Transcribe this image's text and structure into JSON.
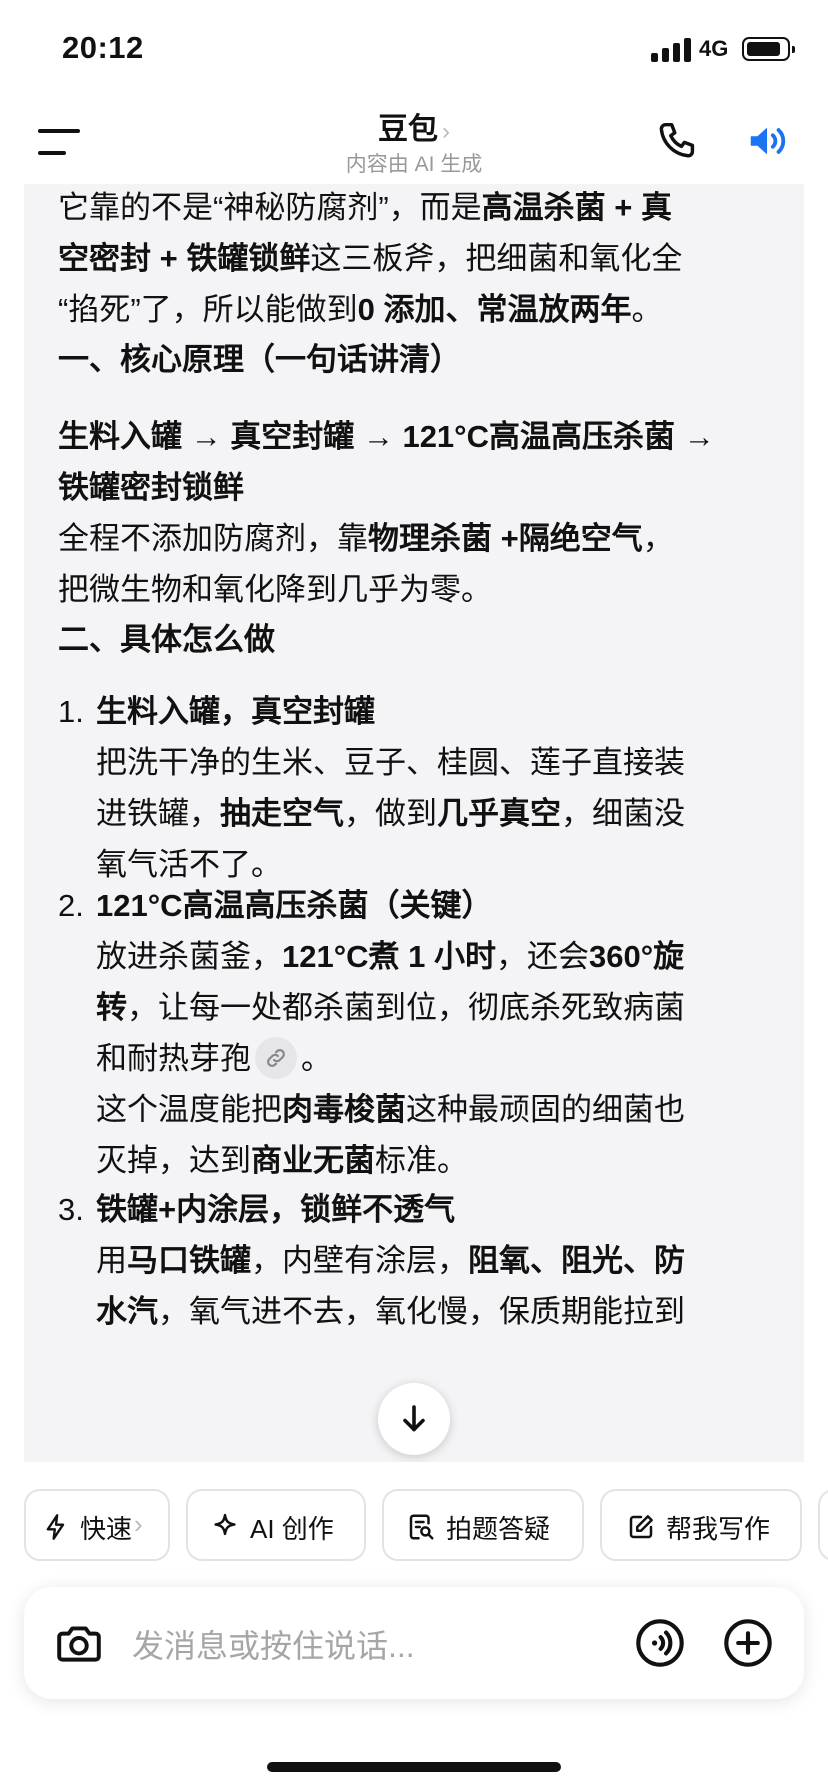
{
  "status": {
    "time": "20:12",
    "network": "4G"
  },
  "nav": {
    "title": "豆包",
    "chevron": "›",
    "subtitle": "内容由 AI 生成"
  },
  "message": {
    "intro_1a": "它靠的不是“神秘防腐剂”，而是",
    "intro_1b": "高温杀菌 + 真",
    "intro_2a": "空密封 + 铁罐锁鲜",
    "intro_2b": "这三板斧，把细菌和氧化全",
    "intro_3a": "“掐死”了，所以能做到",
    "intro_3b": "0 添加、常温放两年",
    "intro_3c": "。",
    "h1": "一、核心原理（一句话讲清）",
    "flow_1": "生料入罐 → 真空封罐 → 121°C高温高压杀菌 →",
    "flow_2": "铁罐密封锁鲜",
    "p1_1a": "全程不添加防腐剂，靠",
    "p1_1b": "物理杀菌 +隔绝空气",
    "p1_1c": "，",
    "p1_2": "把微生物和氧化降到几乎为零。",
    "h2": "二、具体怎么做",
    "s1_num": "1.",
    "s1_title": "生料入罐，真空封罐",
    "s1_l1": "把洗干净的生米、豆子、桂圆、莲子直接装",
    "s1_l2a": "进铁罐，",
    "s1_l2b": "抽走空气",
    "s1_l2c": "，做到",
    "s1_l2d": "几乎真空",
    "s1_l2e": "，细菌没",
    "s1_l3": "氧气活不了。",
    "s2_num": "2.",
    "s2_title": "121°C高温高压杀菌（关键）",
    "s2_l1a": "放进杀菌釜，",
    "s2_l1b": "121°C煮 1 小时",
    "s2_l1c": "，还会",
    "s2_l1d": "360°旋",
    "s2_l2a": "转",
    "s2_l2b": "，让每一处都杀菌到位，彻底杀死致病菌",
    "s2_l3a": "和耐热芽孢",
    "s2_l3b": "。",
    "s2_l4a": "这个温度能把",
    "s2_l4b": "肉毒梭菌",
    "s2_l4c": "这种最顽固的细菌也",
    "s2_l5a": "灭掉，达到",
    "s2_l5b": "商业无菌",
    "s2_l5c": "标准。",
    "s3_num": "3.",
    "s3_title": "铁罐+内涂层，锁鲜不透气",
    "s3_l1a": "用",
    "s3_l1b": "马口铁罐",
    "s3_l1c": "，内壁有涂层，",
    "s3_l1d": "阻氧、阻光、防",
    "s3_l2a": "水汽",
    "s3_l2b": "，氧气进不去，氧化慢，保质期能拉到"
  },
  "chips": [
    {
      "label": "快速",
      "suffix": "›",
      "icon": "lightning-icon"
    },
    {
      "label": "AI 创作",
      "icon": "sparkle-icon"
    },
    {
      "label": "拍题答疑",
      "icon": "photo-search-icon"
    },
    {
      "label": "帮我写作",
      "icon": "edit-icon"
    }
  ],
  "input": {
    "placeholder": "发消息或按住说话..."
  },
  "colors": {
    "accent": "#1a73f5",
    "message_bg": "#f4f4f6"
  }
}
